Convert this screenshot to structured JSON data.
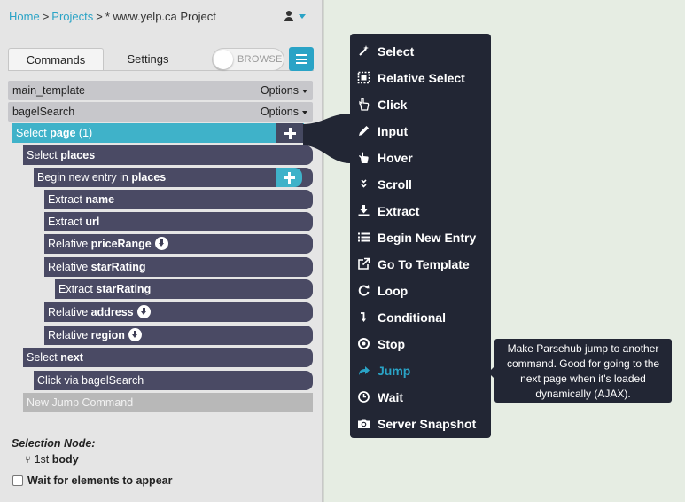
{
  "breadcrumb": {
    "home": "Home",
    "projects": "Projects",
    "current": "* www.yelp.ca Project"
  },
  "user_menu": {
    "icon": "user-icon"
  },
  "tabs": [
    {
      "label": "Commands",
      "active": true
    },
    {
      "label": "Settings",
      "active": false
    }
  ],
  "browse_toggle": {
    "label": "BROWSE",
    "on": false
  },
  "templates": [
    {
      "name": "main_template",
      "options_label": "Options"
    },
    {
      "name": "bagelSearch",
      "options_label": "Options"
    }
  ],
  "commands": [
    {
      "prefix": "Select",
      "target": "page",
      "suffix": "(1)"
    },
    {
      "prefix": "Select",
      "target": "places"
    },
    {
      "prefix": "Begin new entry in",
      "target": "places"
    },
    {
      "prefix": "Extract",
      "target": "name"
    },
    {
      "prefix": "Extract",
      "target": "url"
    },
    {
      "prefix": "Relative",
      "target": "priceRange"
    },
    {
      "prefix": "Relative",
      "target": "starRating"
    },
    {
      "prefix": "Extract",
      "target": "starRating"
    },
    {
      "prefix": "Relative",
      "target": "address"
    },
    {
      "prefix": "Relative",
      "target": "region"
    },
    {
      "prefix": "Select",
      "target": "next"
    },
    {
      "prefix": "Click via bagelSearch"
    }
  ],
  "new_command_placeholder": "New Jump Command",
  "selection_node": {
    "title": "Selection Node:",
    "ordinal": "1st",
    "element": "body"
  },
  "wait_option": {
    "label": "Wait for elements to appear",
    "checked": false
  },
  "menu": {
    "items": [
      {
        "label": "Select",
        "icon": "magic-wand-icon"
      },
      {
        "label": "Relative Select",
        "icon": "relative-select-icon"
      },
      {
        "label": "Click",
        "icon": "pointer-hand-icon"
      },
      {
        "label": "Input",
        "icon": "pencil-icon"
      },
      {
        "label": "Hover",
        "icon": "hover-hand-icon"
      },
      {
        "label": "Scroll",
        "icon": "double-chevron-down-icon"
      },
      {
        "label": "Extract",
        "icon": "download-icon"
      },
      {
        "label": "Begin New Entry",
        "icon": "list-icon"
      },
      {
        "label": "Go To Template",
        "icon": "external-link-icon"
      },
      {
        "label": "Loop",
        "icon": "refresh-icon"
      },
      {
        "label": "Conditional",
        "icon": "level-down-icon"
      },
      {
        "label": "Stop",
        "icon": "stop-circle-icon"
      },
      {
        "label": "Jump",
        "icon": "share-arrow-icon",
        "active": true
      },
      {
        "label": "Wait",
        "icon": "clock-icon"
      },
      {
        "label": "Server Snapshot",
        "icon": "camera-icon"
      }
    ]
  },
  "tooltip": {
    "text": "Make Parsehub jump to another command. Good for going to the next page when it's loaded dynamically (AJAX)."
  },
  "colors": {
    "accent": "#2aa3c6",
    "command_bg": "#4a4a64",
    "selected_bg": "#3fb2c9",
    "menu_bg": "#222634"
  }
}
